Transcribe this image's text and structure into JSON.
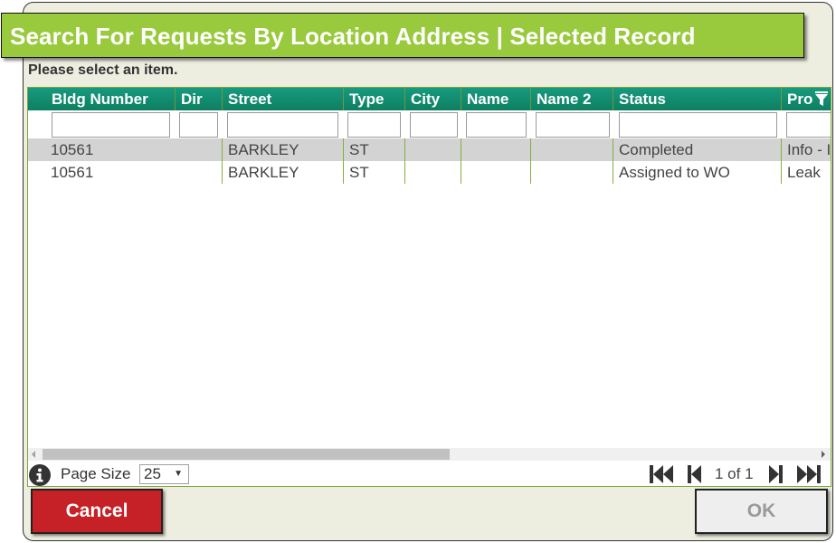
{
  "dialog": {
    "title": "Search For Requests By Location Address | Selected Record",
    "prompt": "Please select an item."
  },
  "grid": {
    "columns": [
      {
        "label": "Bldg Number"
      },
      {
        "label": "Dir"
      },
      {
        "label": "Street"
      },
      {
        "label": "Type"
      },
      {
        "label": "City"
      },
      {
        "label": "Name"
      },
      {
        "label": "Name 2"
      },
      {
        "label": "Status"
      },
      {
        "label": "Pro"
      }
    ],
    "filters": [
      "",
      "",
      "",
      "",
      "",
      "",
      "",
      "",
      ""
    ],
    "rows": [
      {
        "bldg_number": "10561",
        "dir": "",
        "street": "BARKLEY",
        "type": "ST",
        "city": "",
        "name": "",
        "name2": "",
        "status": "Completed",
        "problem": "Info - I",
        "selected": true
      },
      {
        "bldg_number": "10561",
        "dir": "",
        "street": "BARKLEY",
        "type": "ST",
        "city": "",
        "name": "",
        "name2": "",
        "status": "Assigned to WO",
        "problem": "Leak",
        "selected": false
      }
    ]
  },
  "pager": {
    "page_size_label": "Page Size",
    "page_size_value": "25",
    "page_info": "1 of 1"
  },
  "buttons": {
    "cancel": "Cancel",
    "ok": "OK"
  },
  "colors": {
    "title_bar": "#99c93c",
    "header": "#138b6f",
    "cancel": "#c62127",
    "selected_row": "#d3d3d3"
  }
}
